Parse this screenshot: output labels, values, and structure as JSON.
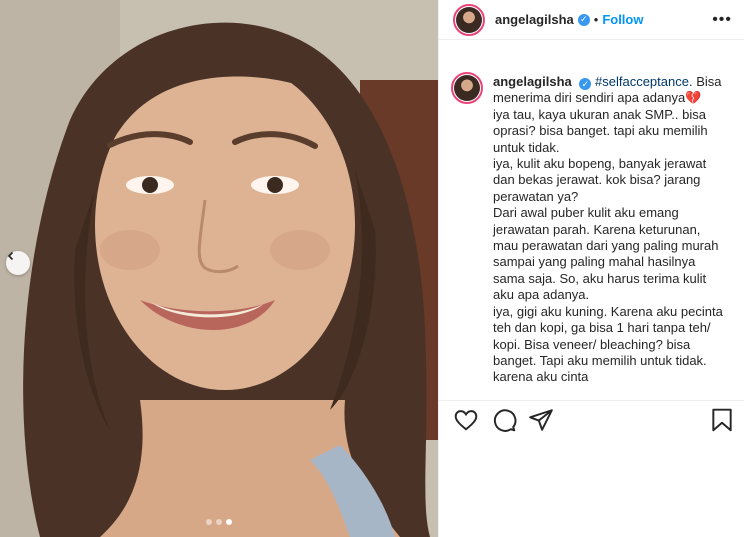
{
  "post": {
    "username": "angelagilsha",
    "verified_mark": "✓",
    "separator": "•",
    "follow_label": "Follow",
    "more_label": "•••"
  },
  "caption": {
    "username": "angelagilsha",
    "verified_mark": "✓",
    "hashtag": "#selfacceptance.",
    "lines": [
      "Bisa menerima diri sendiri apa adanya",
      "iya tau, kaya ukuran anak SMP.. bisa oprasi? bisa banget. tapi aku memilih untuk tidak.",
      "iya, kulit aku bopeng, banyak jerawat dan bekas jerawat. kok bisa? jarang perawatan ya?",
      "Dari awal puber kulit aku emang jerawatan parah. Karena keturunan, mau perawatan dari yang paling murah sampai yang paling mahal hasilnya sama saja. So, aku harus terima kulit aku apa adanya.",
      "iya, gigi aku kuning. Karena aku pecinta teh dan kopi, ga bisa 1 hari tanpa teh/ kopi. Bisa veneer/ bleaching? bisa banget. Tapi aku memilih untuk tidak. karena aku cinta"
    ],
    "emoji": "💔"
  },
  "carousel": {
    "prev_icon": "chevron-left-icon",
    "dots_total": 3,
    "active_dot": 3
  },
  "actions": {
    "icons": [
      "heart-icon",
      "comment-icon",
      "share-icon",
      "bookmark-icon"
    ]
  },
  "colors": {
    "follow": "#0095f6",
    "verified": "#3897f0",
    "hashtag": "#00376b",
    "avatar_ring": "#e9447a"
  }
}
